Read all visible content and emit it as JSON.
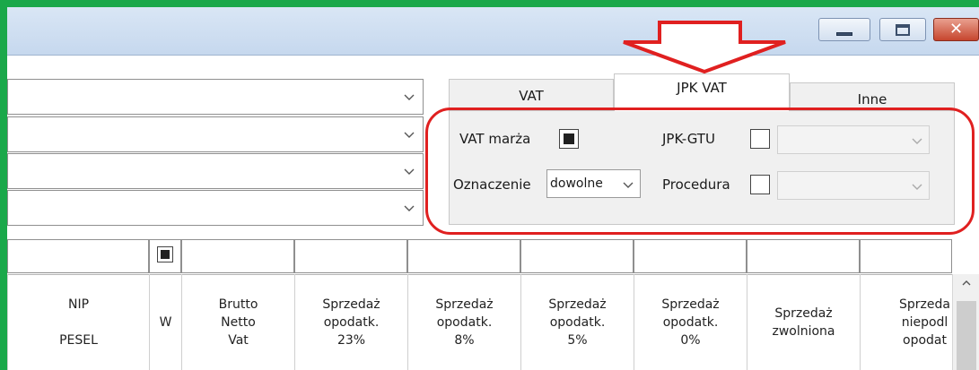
{
  "window": {
    "controls": [
      "minimize-icon",
      "maximize-icon",
      "close-icon"
    ],
    "accent_frame_color": "#1aa84a",
    "annotation_color": "#e02020"
  },
  "filters": {
    "combos": [
      "",
      "",
      "",
      ""
    ]
  },
  "tabs": [
    {
      "label": "VAT",
      "active": false
    },
    {
      "label": "JPK VAT",
      "active": true
    },
    {
      "label": "Inne",
      "active": false
    }
  ],
  "jpk_panel": {
    "vat_marza_label": "VAT marża",
    "vat_marza_checked": true,
    "oznaczenie_label": "Oznaczenie",
    "oznaczenie_value": "dowolne",
    "jpk_gtu_label": "JPK-GTU",
    "jpk_gtu_checked": false,
    "jpk_gtu_value": "",
    "procedura_label": "Procedura",
    "procedura_checked": false,
    "procedura_value": ""
  },
  "grid": {
    "w_filter_checked": true,
    "columns": [
      {
        "label": "NIP\n\nPESEL"
      },
      {
        "label": "W"
      },
      {
        "label": "Brutto\nNetto\nVat"
      },
      {
        "label": "Sprzedaż\nopodatk.\n23%"
      },
      {
        "label": "Sprzedaż\nopodatk.\n8%"
      },
      {
        "label": "Sprzedaż\nopodatk.\n5%"
      },
      {
        "label": "Sprzedaż\nopodatk.\n0%"
      },
      {
        "label": "Sprzedaż\nzwolniona"
      },
      {
        "label": "Sprzeda\nniepodl\nopodat"
      }
    ]
  }
}
